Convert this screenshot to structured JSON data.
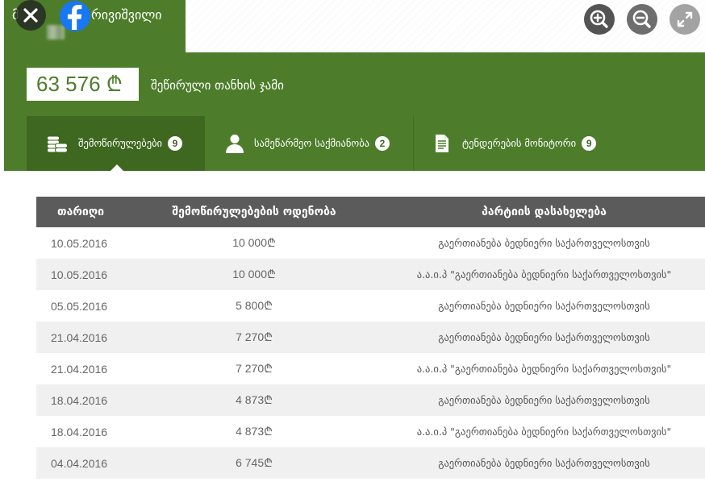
{
  "header": {
    "name_start": "მ",
    "name_end": "რივიშვილი",
    "close_icon": "close-icon",
    "share_icon": "facebook-icon"
  },
  "view_controls": {
    "zoom_in_icon": "zoom-in-icon",
    "zoom_out_icon": "zoom-out-icon",
    "fullscreen_icon": "fullscreen-icon"
  },
  "summary": {
    "amount": "63 576 ₾",
    "label": "შეწირული თანხის ჯამი"
  },
  "tabs": [
    {
      "label": "შემოწირულებები",
      "count": "9",
      "icon": "coins-icon",
      "selected": true
    },
    {
      "label": "სამეწარმეო საქმიანობა",
      "count": "2",
      "icon": "person-icon",
      "selected": false
    },
    {
      "label": "ტენდერების მონიტორი",
      "count": "9",
      "icon": "document-icon",
      "selected": false
    }
  ],
  "table": {
    "columns": [
      "თარიღი",
      "შემოწირულებების ოდენობა",
      "პარტიის დასახელება"
    ],
    "rows": [
      {
        "date": "10.05.2016",
        "amount": "10 000₾",
        "party": "გაერთიანება ბედნიერი საქართველოსთვის"
      },
      {
        "date": "10.05.2016",
        "amount": "10 000₾",
        "party": "ა.ა.ი.პ \"გაერთიანება ბედნიერი საქართველოსთვის\""
      },
      {
        "date": "05.05.2016",
        "amount": "5 800₾",
        "party": "გაერთიანება ბედნიერი საქართველოსთვის"
      },
      {
        "date": "21.04.2016",
        "amount": "7 270₾",
        "party": "გაერთიანება ბედნიერი საქართველოსთვის"
      },
      {
        "date": "21.04.2016",
        "amount": "7 270₾",
        "party": "ა.ა.ი.პ \"გაერთიანება ბედნიერი საქართველოსთვის\""
      },
      {
        "date": "18.04.2016",
        "amount": "4 873₾",
        "party": "გაერთიანება ბედნიერი საქართველოსთვის"
      },
      {
        "date": "18.04.2016",
        "amount": "4 873₾",
        "party": "ა.ა.ი.პ \"გაერთიანება ბედნიერი საქართველოსთვის\""
      },
      {
        "date": "04.04.2016",
        "amount": "6 745₾",
        "party": "გაერთიანება ბედნიერი საქართველოსთვის"
      }
    ]
  },
  "colors": {
    "brand_green": "#4d7d2a",
    "active_tab_green": "#3e6820",
    "table_header": "#5b5b5b",
    "row_alternate": "#f0f0f0",
    "facebook_blue": "#1877f2"
  }
}
